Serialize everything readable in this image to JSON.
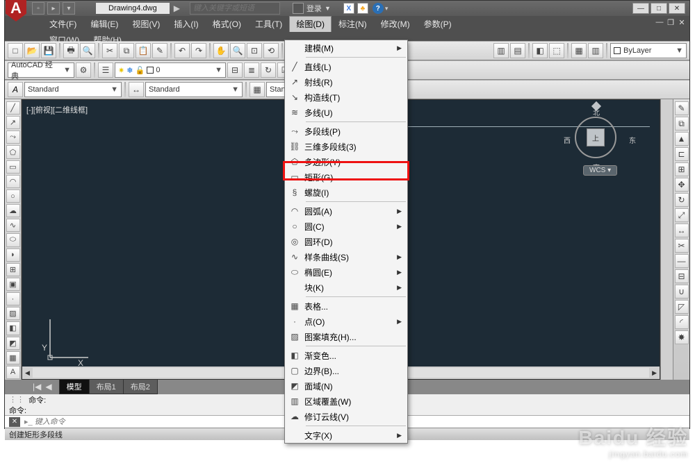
{
  "title_file": "Drawing4.dwg",
  "search_placeholder": "键入关键字或短语",
  "signin": "登录",
  "menus": {
    "file": "文件(F)",
    "edit": "编辑(E)",
    "view": "视图(V)",
    "insert": "插入(I)",
    "format": "格式(O)",
    "tools": "工具(T)",
    "draw": "绘图(D)",
    "dim": "标注(N)",
    "modify": "修改(M)",
    "param": "参数(P)",
    "window": "窗口(W)",
    "help": "帮助(H)"
  },
  "workspace": "AutoCAD 经典",
  "layer0": "0",
  "bylayer": "ByLayer",
  "style1": "Standard",
  "style2": "Standard",
  "style3": "Standard",
  "viewlabel": "[-][俯视][二维线框]",
  "nav": {
    "n": "北",
    "s": "南",
    "e": "东",
    "w": "西",
    "face": "上",
    "wcs": "WCS"
  },
  "tabs": {
    "model": "模型",
    "layout1": "布局1",
    "layout2": "布局2"
  },
  "ucs": {
    "x": "X",
    "y": "Y"
  },
  "cmd_prompt": "命令:",
  "cmd_input_ph": "键入命令",
  "status": "创建矩形多段线",
  "dropmenu": [
    {
      "t": "建模(M)",
      "arrow": true,
      "ico": ""
    },
    {
      "sep": true
    },
    {
      "t": "直线(L)",
      "ico": "╱"
    },
    {
      "t": "射线(R)",
      "ico": "↗"
    },
    {
      "t": "构造线(T)",
      "ico": "↘"
    },
    {
      "t": "多线(U)",
      "ico": "≋"
    },
    {
      "sep": true
    },
    {
      "t": "多段线(P)",
      "ico": "⤳"
    },
    {
      "t": "三维多段线(3)",
      "ico": "⛓"
    },
    {
      "t": "多边形(Y)",
      "ico": "⬠"
    },
    {
      "t": "矩形(G)",
      "ico": "▭"
    },
    {
      "t": "螺旋(I)",
      "ico": "§"
    },
    {
      "sep": true
    },
    {
      "t": "圆弧(A)",
      "arrow": true,
      "ico": "◠"
    },
    {
      "t": "圆(C)",
      "arrow": true,
      "ico": "○"
    },
    {
      "t": "圆环(D)",
      "ico": "◎"
    },
    {
      "t": "样条曲线(S)",
      "arrow": true,
      "ico": "∿"
    },
    {
      "t": "椭圆(E)",
      "arrow": true,
      "ico": "⬭"
    },
    {
      "t": "块(K)",
      "arrow": true,
      "ico": ""
    },
    {
      "sep": true
    },
    {
      "t": "表格...",
      "ico": "▦"
    },
    {
      "t": "点(O)",
      "arrow": true,
      "ico": "·"
    },
    {
      "t": "图案填充(H)...",
      "ico": "▨"
    },
    {
      "sep": true
    },
    {
      "t": "渐变色...",
      "ico": "◧"
    },
    {
      "t": "边界(B)...",
      "ico": "▢"
    },
    {
      "t": "面域(N)",
      "ico": "◩"
    },
    {
      "t": "区域覆盖(W)",
      "ico": "▥"
    },
    {
      "t": "修订云线(V)",
      "ico": "☁"
    },
    {
      "sep": true
    },
    {
      "t": "文字(X)",
      "arrow": true,
      "ico": ""
    }
  ],
  "watermark": {
    "main": "Baidu 经验",
    "sub": "jingyan.baidu.com"
  }
}
